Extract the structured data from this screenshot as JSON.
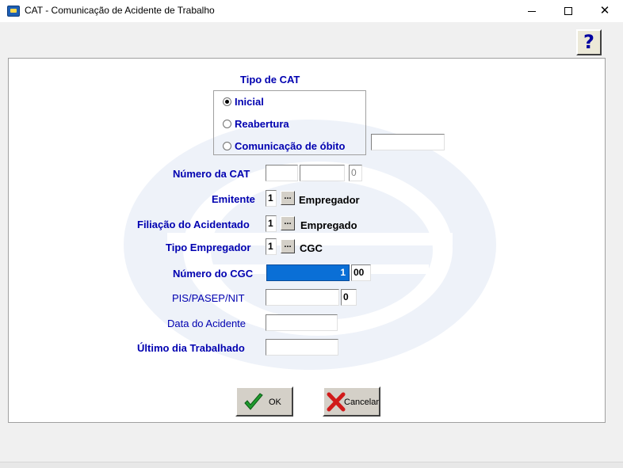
{
  "window": {
    "title": "CAT - Comunicação de Acidente de Trabalho",
    "help_label": "?"
  },
  "tipo_cat": {
    "title": "Tipo de CAT",
    "options": [
      {
        "label": "Inicial",
        "selected": true
      },
      {
        "label": "Reabertura",
        "selected": false
      },
      {
        "label": "Comunicação de óbito",
        "selected": false
      }
    ],
    "obito_value": ""
  },
  "numero_cat": {
    "label": "Número da CAT",
    "part1": "",
    "part2": "",
    "digit": "0"
  },
  "emitente": {
    "label": "Emitente",
    "code": "1",
    "button": "...",
    "description": "Empregador"
  },
  "filiacao": {
    "label": "Filiação do Acidentado",
    "code": "1",
    "button": "...",
    "description": "Empregado"
  },
  "tipo_empregador": {
    "label": "Tipo Empregador",
    "code": "1",
    "button": "...",
    "description": "CGC"
  },
  "numero_cgc": {
    "label": "Número do CGC",
    "value": "1",
    "suffix": "00",
    "highlight_color": "#0a6fd6"
  },
  "pis": {
    "label": "PIS/PASEP/NIT",
    "value": "",
    "digit": "0"
  },
  "data_acidente": {
    "label": "Data do Acidente",
    "value": ""
  },
  "ultimo_dia": {
    "label": "Último dia Trabalhado",
    "value": ""
  },
  "buttons": {
    "ok": "OK",
    "cancel": "Cancelar"
  },
  "colors": {
    "label_blue": "#0000b0",
    "watermark": "#e8eef7"
  }
}
